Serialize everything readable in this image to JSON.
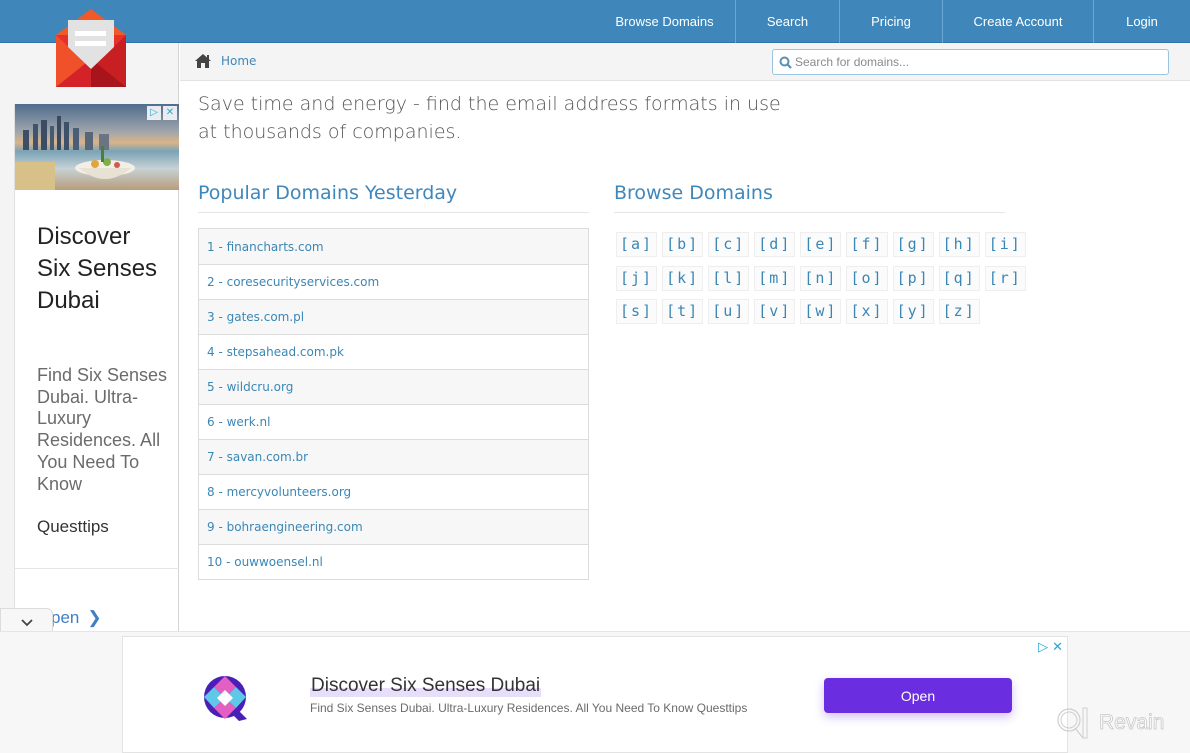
{
  "nav": {
    "items": [
      {
        "label": "Browse Domains"
      },
      {
        "label": "Search"
      },
      {
        "label": "Pricing"
      },
      {
        "label": "Create Account"
      },
      {
        "label": "Login"
      }
    ]
  },
  "breadcrumb": {
    "home_label": "Home"
  },
  "search": {
    "placeholder": "Search for domains...",
    "value": ""
  },
  "main": {
    "tagline": "Save time and energy - find the email address formats in use at thousands of companies.",
    "popular": {
      "title": "Popular Domains Yesterday",
      "items": [
        {
          "label": "1 - financharts.com"
        },
        {
          "label": "2 - coresecurityservices.com"
        },
        {
          "label": "3 - gates.com.pl"
        },
        {
          "label": "4 - stepsahead.com.pk"
        },
        {
          "label": "5 - wildcru.org"
        },
        {
          "label": "6 - werk.nl"
        },
        {
          "label": "7 - savan.com.br"
        },
        {
          "label": "8 - mercyvolunteers.org"
        },
        {
          "label": "9 - bohraengineering.com"
        },
        {
          "label": "10 - ouwwoensel.nl"
        }
      ]
    },
    "browse": {
      "title": "Browse Domains",
      "rows": [
        [
          "[a]",
          "[b]",
          "[c]",
          "[d]",
          "[e]",
          "[f]",
          "[g]",
          "[h]",
          "[i]"
        ],
        [
          "[j]",
          "[k]",
          "[l]",
          "[m]",
          "[n]",
          "[o]",
          "[p]",
          "[q]",
          "[r]"
        ],
        [
          "[s]",
          "[t]",
          "[u]",
          "[v]",
          "[w]",
          "[x]",
          "[y]",
          "[z]"
        ]
      ]
    }
  },
  "side_ad": {
    "headline": "Discover Six Senses Dubai",
    "body": "Find Six Senses Dubai. Ultra-Luxury Residences. All You Need To Know",
    "advertiser": "Questtips",
    "open_label": "pen",
    "adchoices_icon": "▷",
    "close_icon": "✕",
    "collapse_icon": "⌄"
  },
  "bottom_ad": {
    "title": "Discover Six Senses Dubai",
    "description": "Find Six Senses Dubai. Ultra-Luxury Residences. All You Need To Know Questtips",
    "open_label": "Open",
    "adchoices_icon": "▷",
    "close_icon": "✕"
  },
  "watermark": {
    "label": "Revain"
  },
  "colors": {
    "brand_blue": "#3f87ba",
    "link_blue": "#3a87b5",
    "ad_button_purple": "#6a2ee0",
    "logo_red": "#e8312b"
  }
}
